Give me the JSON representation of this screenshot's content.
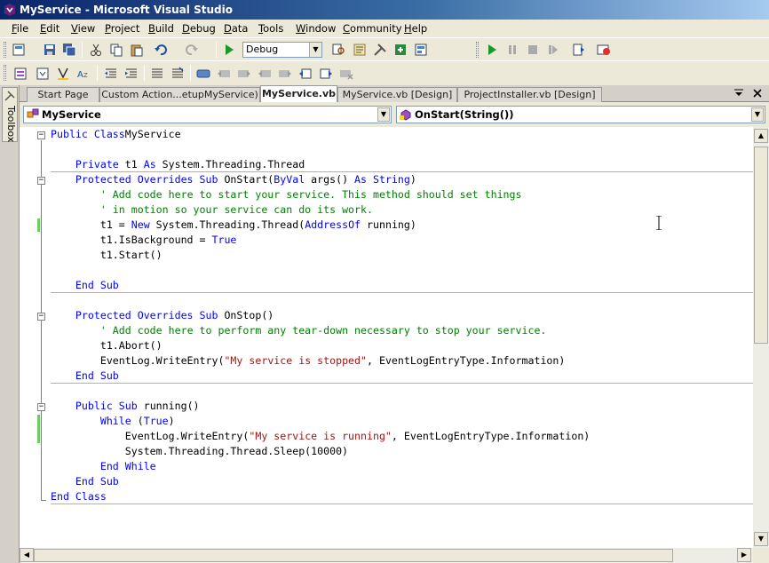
{
  "window": {
    "title": "MyService - Microsoft Visual Studio"
  },
  "menu": [
    "File",
    "Edit",
    "View",
    "Project",
    "Build",
    "Debug",
    "Data",
    "Tools",
    "Window",
    "Community",
    "Help"
  ],
  "toolbar": {
    "configuration": "Debug",
    "icons": [
      "new-project-icon",
      "open-icon",
      "save-icon",
      "save-all-icon",
      "cut-icon",
      "copy-icon",
      "paste-icon",
      "undo-icon",
      "redo-icon",
      "start-debug-icon",
      "find-icon",
      "properties-icon",
      "toolbox-icon",
      "object-browser-icon",
      "solution-explorer-icon",
      "play-icon",
      "pause-icon",
      "stop-icon",
      "restart-icon",
      "breakpoints-icon",
      "window-icon"
    ]
  },
  "toolbox": {
    "label": "Toolbox"
  },
  "tabs": [
    {
      "label": "Start Page"
    },
    {
      "label": "Custom Action...etupMyService)"
    },
    {
      "label": "MyService.vb"
    },
    {
      "label": "MyService.vb [Design]"
    },
    {
      "label": "ProjectInstaller.vb [Design]"
    }
  ],
  "active_tab": "MyService.vb",
  "nav": {
    "class_combo": "MyService",
    "member_combo": "OnStart(String())"
  },
  "code": {
    "lines": [
      [
        [
          "kw",
          "Public Class"
        ],
        [
          "",
          "MyService"
        ]
      ],
      [],
      [
        [
          "",
          "    "
        ],
        [
          "kw",
          "Private"
        ],
        [
          "",
          " t1 "
        ],
        [
          "kw",
          "As"
        ],
        [
          "",
          " System.Threading.Thread"
        ]
      ],
      [
        [
          "",
          "    "
        ],
        [
          "kw",
          "Protected Overrides Sub"
        ],
        [
          "",
          " OnStart("
        ],
        [
          "kw",
          "ByVal"
        ],
        [
          "",
          " args() "
        ],
        [
          "kw",
          "As String"
        ],
        [
          "",
          ")"
        ]
      ],
      [
        [
          "",
          "        "
        ],
        [
          "cm",
          "' Add code here to start your service. This method should set things"
        ]
      ],
      [
        [
          "",
          "        "
        ],
        [
          "cm",
          "' in motion so your service can do its work."
        ]
      ],
      [
        [
          "",
          "        t1 = "
        ],
        [
          "kw",
          "New"
        ],
        [
          "",
          " System.Threading.Thread("
        ],
        [
          "kw",
          "AddressOf"
        ],
        [
          "",
          " running)"
        ]
      ],
      [
        [
          "",
          "        t1.IsBackground = "
        ],
        [
          "kw",
          "True"
        ]
      ],
      [
        [
          "",
          "        t1.Start()"
        ]
      ],
      [],
      [
        [
          "",
          "    "
        ],
        [
          "kw",
          "End Sub"
        ]
      ],
      [],
      [
        [
          "",
          "    "
        ],
        [
          "kw",
          "Protected Overrides Sub"
        ],
        [
          "",
          " OnStop()"
        ]
      ],
      [
        [
          "",
          "        "
        ],
        [
          "cm",
          "' Add code here to perform any tear-down necessary to stop your service."
        ]
      ],
      [
        [
          "",
          "        t1.Abort()"
        ]
      ],
      [
        [
          "",
          "        EventLog.WriteEntry("
        ],
        [
          "str",
          "\"My service is stopped\""
        ],
        [
          "",
          ", EventLogEntryType.Information)"
        ]
      ],
      [
        [
          "",
          "    "
        ],
        [
          "kw",
          "End Sub"
        ]
      ],
      [],
      [
        [
          "",
          "    "
        ],
        [
          "kw",
          "Public Sub"
        ],
        [
          "",
          " running()"
        ]
      ],
      [
        [
          "",
          "        "
        ],
        [
          "kw",
          "While"
        ],
        [
          "",
          " ("
        ],
        [
          "kw",
          "True"
        ],
        [
          "",
          ")"
        ]
      ],
      [
        [
          "",
          "            EventLog.WriteEntry("
        ],
        [
          "str",
          "\"My service is running\""
        ],
        [
          "",
          ", EventLogEntryType.Information)"
        ]
      ],
      [
        [
          "",
          "            System.Threading.Thread.Sleep(10000)"
        ]
      ],
      [
        [
          "",
          "        "
        ],
        [
          "kw",
          "End While"
        ]
      ],
      [
        [
          "",
          "    "
        ],
        [
          "kw",
          "End Sub"
        ]
      ],
      [
        [
          "kw",
          "End Class"
        ]
      ]
    ]
  }
}
